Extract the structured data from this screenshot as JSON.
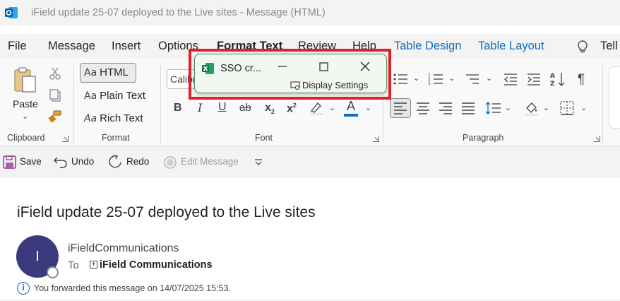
{
  "window": {
    "title": "iField update 25-07 deployed to the Live sites  -  Message (HTML)"
  },
  "menu": {
    "tabs": [
      "File",
      "Message",
      "Insert",
      "Options",
      "Format Text",
      "Review",
      "Help",
      "Table Design",
      "Table Layout",
      "Tell"
    ]
  },
  "ribbon": {
    "clipboard": {
      "paste_label": "Paste",
      "group_label": "Clipboard"
    },
    "format": {
      "html_label": "HTML",
      "plain_label": "Plain Text",
      "rich_label": "Rich Text",
      "group_label": "Format",
      "aa_glyph": "Aa"
    },
    "font": {
      "font_name": "Calibri",
      "group_label": "Font",
      "bold": "B",
      "italic": "I",
      "underline": "U",
      "strike": "ab",
      "sub": "x",
      "sup": "x",
      "font_color_glyph": "A",
      "font_color": "#0f6cbd"
    },
    "paragraph": {
      "group_label": "Paragraph",
      "pilcrow": "¶"
    }
  },
  "quick_access": {
    "save_label": "Save",
    "undo_label": "Undo",
    "redo_label": "Redo",
    "edit_label": "Edit Message"
  },
  "message": {
    "subject": "iField update 25-07 deployed to the Live sites",
    "avatar_initial": "I",
    "sender": "iFieldCommunications",
    "to_label": "To",
    "recipient": "iField Communications",
    "forwarded_notice": "You forwarded this message on 14/07/2025 15:53."
  },
  "popup": {
    "title": "SSO cr...",
    "subtitle": "Display Settings"
  },
  "colors": {
    "accent": "#0f6cbd",
    "highlight_frame": "#e0202a",
    "excel_green": "#107c41",
    "avatar": "#3b3a7c"
  }
}
